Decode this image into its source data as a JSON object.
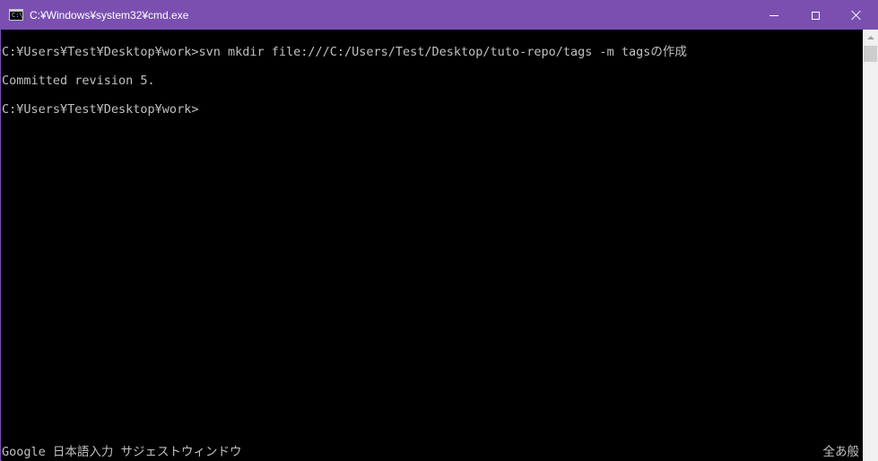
{
  "window": {
    "title": "C:¥Windows¥system32¥cmd.exe",
    "icon_name": "cmd-icon",
    "icon_text": "C:\\",
    "accent_color": "#7a4fb0"
  },
  "console": {
    "lines": [
      "C:¥Users¥Test¥Desktop¥work>svn mkdir file:///C:/Users/Test/Desktop/tuto-repo/tags -m tagsの作成",
      "Committed revision 5.",
      "C:¥Users¥Test¥Desktop¥work>"
    ]
  },
  "ime": {
    "left_text": "Google 日本語入力 サジェストウィンドウ",
    "right_text": "全あ般"
  }
}
